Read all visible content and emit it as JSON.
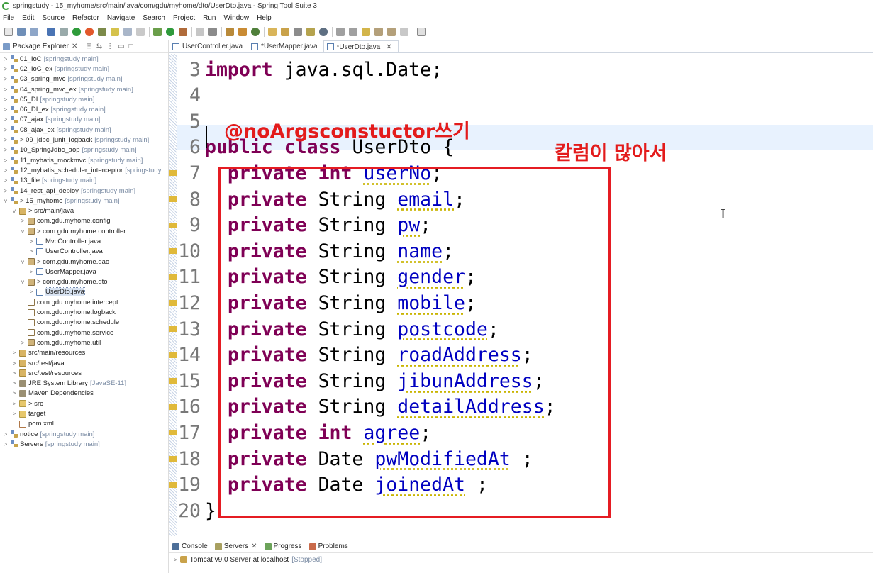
{
  "window": {
    "title": "springstudy - 15_myhome/src/main/java/com/gdu/myhome/dto/UserDto.java - Spring Tool Suite 3"
  },
  "menu": [
    "File",
    "Edit",
    "Source",
    "Refactor",
    "Navigate",
    "Search",
    "Project",
    "Run",
    "Window",
    "Help"
  ],
  "explorer": {
    "title": "Package Explorer",
    "rows": [
      {
        "indent": 0,
        "tw": ">",
        "icon": "proj",
        "label": "01_IoC",
        "dec": "[springstudy main]"
      },
      {
        "indent": 0,
        "tw": ">",
        "icon": "proj",
        "label": "02_IoC_ex",
        "dec": "[springstudy main]"
      },
      {
        "indent": 0,
        "tw": ">",
        "icon": "proj",
        "label": "03_spring_mvc",
        "dec": "[springstudy main]"
      },
      {
        "indent": 0,
        "tw": ">",
        "icon": "proj",
        "label": "04_spring_mvc_ex",
        "dec": "[springstudy main]"
      },
      {
        "indent": 0,
        "tw": ">",
        "icon": "proj",
        "label": "05_DI",
        "dec": "[springstudy main]"
      },
      {
        "indent": 0,
        "tw": ">",
        "icon": "proj",
        "label": "06_DI_ex",
        "dec": "[springstudy main]"
      },
      {
        "indent": 0,
        "tw": ">",
        "icon": "proj",
        "label": "07_ajax",
        "dec": "[springstudy main]"
      },
      {
        "indent": 0,
        "tw": ">",
        "icon": "proj",
        "label": "08_ajax_ex",
        "dec": "[springstudy main]"
      },
      {
        "indent": 0,
        "tw": ">",
        "icon": "proj",
        "label": "> 09_jdbc_junit_logback",
        "dec": "[springstudy main]"
      },
      {
        "indent": 0,
        "tw": ">",
        "icon": "proj",
        "label": "10_SpringJdbc_aop",
        "dec": "[springstudy main]"
      },
      {
        "indent": 0,
        "tw": ">",
        "icon": "proj",
        "label": "11_mybatis_mockmvc",
        "dec": "[springstudy main]"
      },
      {
        "indent": 0,
        "tw": ">",
        "icon": "proj",
        "label": "12_mybatis_scheduler_interceptor",
        "dec": "[springstudy"
      },
      {
        "indent": 0,
        "tw": ">",
        "icon": "proj",
        "label": "13_file",
        "dec": "[springstudy main]"
      },
      {
        "indent": 0,
        "tw": ">",
        "icon": "proj",
        "label": "14_rest_api_deploy",
        "dec": "[springstudy main]"
      },
      {
        "indent": 0,
        "tw": "v",
        "icon": "proj",
        "label": "> 15_myhome",
        "dec": "[springstudy main]"
      },
      {
        "indent": 1,
        "tw": "v",
        "icon": "src",
        "label": "> src/main/java",
        "dec": ""
      },
      {
        "indent": 2,
        "tw": ">",
        "icon": "pkg",
        "label": "com.gdu.myhome.config",
        "dec": ""
      },
      {
        "indent": 2,
        "tw": "v",
        "icon": "pkg",
        "label": "> com.gdu.myhome.controller",
        "dec": ""
      },
      {
        "indent": 3,
        "tw": ">",
        "icon": "java",
        "label": "MvcController.java",
        "dec": ""
      },
      {
        "indent": 3,
        "tw": ">",
        "icon": "java",
        "label": "UserController.java",
        "dec": ""
      },
      {
        "indent": 2,
        "tw": "v",
        "icon": "pkg",
        "label": "> com.gdu.myhome.dao",
        "dec": ""
      },
      {
        "indent": 3,
        "tw": ">",
        "icon": "java",
        "label": "UserMapper.java",
        "dec": ""
      },
      {
        "indent": 2,
        "tw": "v",
        "icon": "pkg",
        "label": "> com.gdu.myhome.dto",
        "dec": ""
      },
      {
        "indent": 3,
        "tw": ">",
        "icon": "java",
        "label": "UserDto.java",
        "dec": "",
        "selected": true
      },
      {
        "indent": 2,
        "tw": "",
        "icon": "pkg-empty",
        "label": "com.gdu.myhome.intercept",
        "dec": ""
      },
      {
        "indent": 2,
        "tw": "",
        "icon": "pkg-empty",
        "label": "com.gdu.myhome.logback",
        "dec": ""
      },
      {
        "indent": 2,
        "tw": "",
        "icon": "pkg-empty",
        "label": "com.gdu.myhome.schedule",
        "dec": ""
      },
      {
        "indent": 2,
        "tw": "",
        "icon": "pkg-empty",
        "label": "com.gdu.myhome.service",
        "dec": ""
      },
      {
        "indent": 2,
        "tw": ">",
        "icon": "pkg",
        "label": "com.gdu.myhome.util",
        "dec": ""
      },
      {
        "indent": 1,
        "tw": ">",
        "icon": "src",
        "label": "src/main/resources",
        "dec": ""
      },
      {
        "indent": 1,
        "tw": ">",
        "icon": "src",
        "label": "src/test/java",
        "dec": ""
      },
      {
        "indent": 1,
        "tw": ">",
        "icon": "src",
        "label": "src/test/resources",
        "dec": ""
      },
      {
        "indent": 1,
        "tw": ">",
        "icon": "jar",
        "label": "JRE System Library",
        "dec": "[JavaSE-11]"
      },
      {
        "indent": 1,
        "tw": ">",
        "icon": "jar",
        "label": "Maven Dependencies",
        "dec": ""
      },
      {
        "indent": 1,
        "tw": ">",
        "icon": "folder",
        "label": "> src",
        "dec": ""
      },
      {
        "indent": 1,
        "tw": ">",
        "icon": "folder",
        "label": "target",
        "dec": ""
      },
      {
        "indent": 1,
        "tw": "",
        "icon": "xml",
        "label": "pom.xml",
        "dec": ""
      },
      {
        "indent": 0,
        "tw": ">",
        "icon": "proj",
        "label": "notice",
        "dec": "[springstudy main]"
      },
      {
        "indent": 0,
        "tw": ">",
        "icon": "proj",
        "label": "Servers",
        "dec": "[springstudy main]"
      }
    ]
  },
  "editor": {
    "tabs": [
      {
        "label": "UserController.java",
        "active": false
      },
      {
        "label": "*UserMapper.java",
        "active": false
      },
      {
        "label": "*UserDto.java",
        "active": true
      }
    ],
    "lines": [
      {
        "n": "3",
        "parts": [
          {
            "t": "import",
            "c": "kw"
          },
          {
            "t": " java.sql.Date;",
            "c": ""
          }
        ]
      },
      {
        "n": "4",
        "parts": []
      },
      {
        "n": "5",
        "parts": []
      },
      {
        "n": "6",
        "parts": [
          {
            "t": "public",
            "c": "kw"
          },
          {
            "t": " ",
            "c": ""
          },
          {
            "t": "class",
            "c": "kw"
          },
          {
            "t": " UserDto {",
            "c": ""
          }
        ]
      },
      {
        "n": "7",
        "parts": [
          {
            "t": "  ",
            "c": ""
          },
          {
            "t": "private",
            "c": "kw"
          },
          {
            "t": " ",
            "c": ""
          },
          {
            "t": "int",
            "c": "kw"
          },
          {
            "t": " ",
            "c": ""
          },
          {
            "t": "userNo",
            "c": "fld"
          },
          {
            "t": ";",
            "c": ""
          }
        ]
      },
      {
        "n": "8",
        "parts": [
          {
            "t": "  ",
            "c": ""
          },
          {
            "t": "private",
            "c": "kw"
          },
          {
            "t": " String ",
            "c": ""
          },
          {
            "t": "email",
            "c": "fld"
          },
          {
            "t": ";",
            "c": ""
          }
        ]
      },
      {
        "n": "9",
        "parts": [
          {
            "t": "  ",
            "c": ""
          },
          {
            "t": "private",
            "c": "kw"
          },
          {
            "t": " String ",
            "c": ""
          },
          {
            "t": "pw",
            "c": "fld"
          },
          {
            "t": ";",
            "c": ""
          }
        ]
      },
      {
        "n": "10",
        "parts": [
          {
            "t": "  ",
            "c": ""
          },
          {
            "t": "private",
            "c": "kw"
          },
          {
            "t": " String ",
            "c": ""
          },
          {
            "t": "name",
            "c": "fld"
          },
          {
            "t": ";",
            "c": ""
          }
        ]
      },
      {
        "n": "11",
        "parts": [
          {
            "t": "  ",
            "c": ""
          },
          {
            "t": "private",
            "c": "kw"
          },
          {
            "t": " String ",
            "c": ""
          },
          {
            "t": "gender",
            "c": "fld"
          },
          {
            "t": ";",
            "c": ""
          }
        ]
      },
      {
        "n": "12",
        "parts": [
          {
            "t": "  ",
            "c": ""
          },
          {
            "t": "private",
            "c": "kw"
          },
          {
            "t": " String ",
            "c": ""
          },
          {
            "t": "mobile",
            "c": "fld"
          },
          {
            "t": ";",
            "c": ""
          }
        ]
      },
      {
        "n": "13",
        "parts": [
          {
            "t": "  ",
            "c": ""
          },
          {
            "t": "private",
            "c": "kw"
          },
          {
            "t": " String ",
            "c": ""
          },
          {
            "t": "postcode",
            "c": "fld"
          },
          {
            "t": ";",
            "c": ""
          }
        ]
      },
      {
        "n": "14",
        "parts": [
          {
            "t": "  ",
            "c": ""
          },
          {
            "t": "private",
            "c": "kw"
          },
          {
            "t": " String ",
            "c": ""
          },
          {
            "t": "roadAddress",
            "c": "fld"
          },
          {
            "t": ";",
            "c": ""
          }
        ]
      },
      {
        "n": "15",
        "parts": [
          {
            "t": "  ",
            "c": ""
          },
          {
            "t": "private",
            "c": "kw"
          },
          {
            "t": " String ",
            "c": ""
          },
          {
            "t": "jibunAddress",
            "c": "fld"
          },
          {
            "t": ";",
            "c": ""
          }
        ]
      },
      {
        "n": "16",
        "parts": [
          {
            "t": "  ",
            "c": ""
          },
          {
            "t": "private",
            "c": "kw"
          },
          {
            "t": " String ",
            "c": ""
          },
          {
            "t": "detailAddress",
            "c": "fld"
          },
          {
            "t": ";",
            "c": ""
          }
        ]
      },
      {
        "n": "17",
        "parts": [
          {
            "t": "  ",
            "c": ""
          },
          {
            "t": "private",
            "c": "kw"
          },
          {
            "t": " ",
            "c": ""
          },
          {
            "t": "int",
            "c": "kw"
          },
          {
            "t": " ",
            "c": ""
          },
          {
            "t": "agree",
            "c": "fld"
          },
          {
            "t": ";",
            "c": ""
          }
        ]
      },
      {
        "n": "18",
        "parts": [
          {
            "t": "  ",
            "c": ""
          },
          {
            "t": "private",
            "c": "kw"
          },
          {
            "t": " Date ",
            "c": ""
          },
          {
            "t": "pwModifiedAt",
            "c": "fld"
          },
          {
            "t": " ;",
            "c": ""
          }
        ]
      },
      {
        "n": "19",
        "parts": [
          {
            "t": "  ",
            "c": ""
          },
          {
            "t": "private",
            "c": "kw"
          },
          {
            "t": " Date ",
            "c": ""
          },
          {
            "t": "joinedAt",
            "c": "fld"
          },
          {
            "t": " ;",
            "c": ""
          }
        ]
      },
      {
        "n": "20",
        "parts": [
          {
            "t": "}",
            "c": ""
          }
        ]
      }
    ],
    "annotation_main": "@noArgsconstuctor쓰기",
    "annotation_side": "칼럼이 많아서",
    "annotation_color": "#e31b1b"
  },
  "bottom": {
    "tabs": [
      "Console",
      "Servers",
      "Progress",
      "Problems"
    ],
    "server": {
      "label": "Tomcat v9.0 Server at localhost",
      "status": "[Stopped]"
    }
  }
}
